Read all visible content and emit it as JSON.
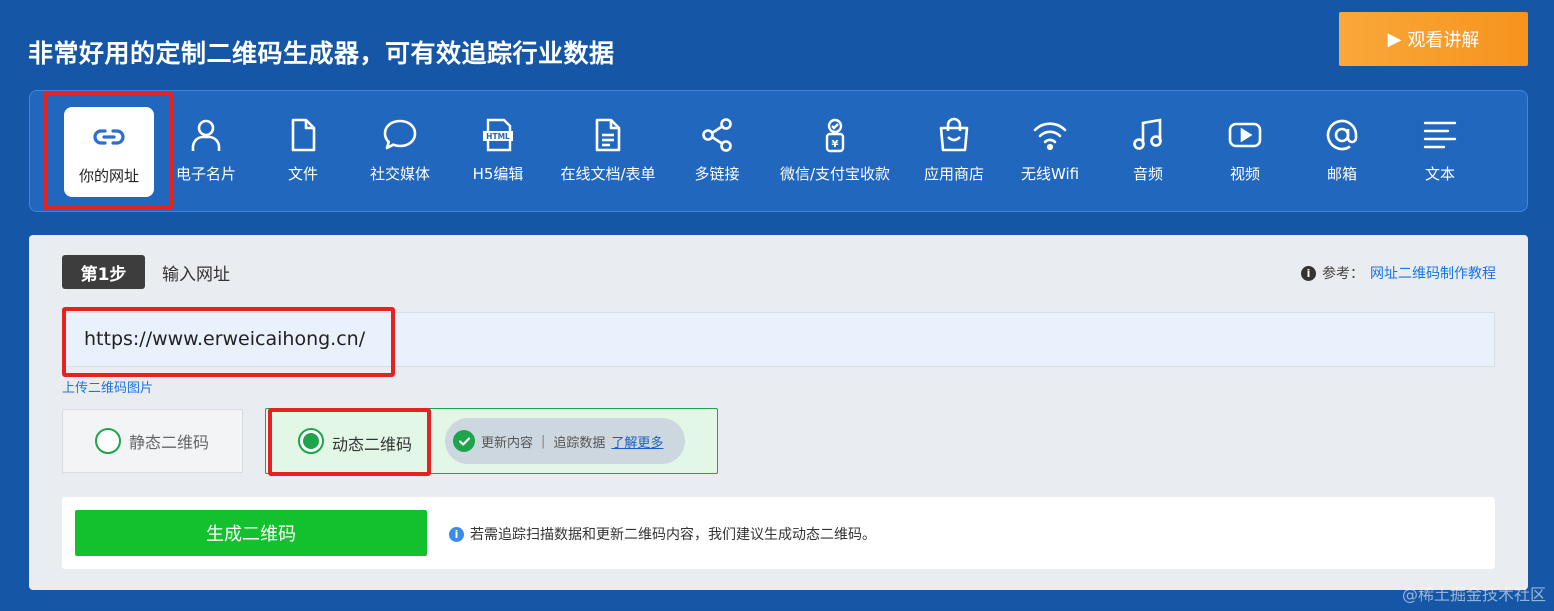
{
  "header": {
    "title": "非常好用的定制二维码生成器，可有效追踪行业数据",
    "watch_label": "观看讲解",
    "watch_icon": "play-icon"
  },
  "toolbar": {
    "items": [
      {
        "label": "你的网址",
        "icon": "link-icon",
        "active": true
      },
      {
        "label": "电子名片",
        "icon": "person-icon"
      },
      {
        "label": "文件",
        "icon": "file-icon"
      },
      {
        "label": "社交媒体",
        "icon": "chat-bubble-icon"
      },
      {
        "label": "H5编辑",
        "icon": "html-icon"
      },
      {
        "label": "在线文档/表单",
        "icon": "document-icon"
      },
      {
        "label": "多链接",
        "icon": "share-icon"
      },
      {
        "label": "微信/支付宝收款",
        "icon": "payment-icon"
      },
      {
        "label": "应用商店",
        "icon": "shopping-bag-icon"
      },
      {
        "label": "无线Wifi",
        "icon": "wifi-icon"
      },
      {
        "label": "音频",
        "icon": "music-icon"
      },
      {
        "label": "视频",
        "icon": "video-icon"
      },
      {
        "label": "邮箱",
        "icon": "at-icon"
      },
      {
        "label": "文本",
        "icon": "text-lines-icon"
      }
    ]
  },
  "step": {
    "badge": "第1步",
    "title": "输入网址",
    "ref_prefix": "参考：",
    "ref_link": "网址二维码制作教程"
  },
  "url_input": {
    "value": "https://www.erweicaihong.cn/"
  },
  "upload_link": "上传二维码图片",
  "options": {
    "static_label": "静态二维码",
    "dynamic_label": "动态二维码",
    "selected": "dynamic",
    "feature_update": "更新内容",
    "feature_separator": "|",
    "feature_track": "追踪数据",
    "learn_more": "了解更多"
  },
  "generate": {
    "button_label": "生成二维码",
    "tip": "若需追踪扫描数据和更新二维码内容，我们建议生成动态二维码。"
  },
  "watermark": "@稀土掘金技术社区",
  "colors": {
    "background": "#1557a6",
    "accent_green": "#13c02d",
    "accent_orange": "#f7931e",
    "highlight_red": "#e52222",
    "link_blue": "#1a73e8"
  }
}
